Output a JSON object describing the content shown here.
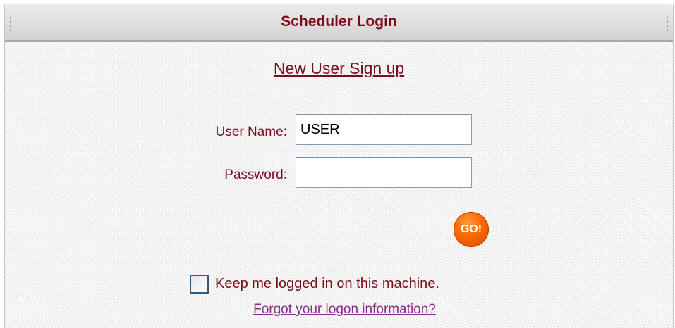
{
  "header": {
    "title": "Scheduler Login"
  },
  "signup": {
    "link_text": "New User Sign up"
  },
  "form": {
    "username_label": "User Name:",
    "username_value": "USER",
    "password_label": "Password:",
    "password_value": "",
    "submit_label": "GO!"
  },
  "remember": {
    "label": "Keep me logged in on this machine.",
    "checked": false
  },
  "forgot": {
    "link_text": "Forgot your logon information?"
  },
  "colors": {
    "title_text": "#7a0d1c",
    "label_text": "#7a0d1c",
    "visited_link": "#8b2a8e",
    "go_button": "#ff6a00",
    "checkbox_border": "#2f5a8a"
  }
}
